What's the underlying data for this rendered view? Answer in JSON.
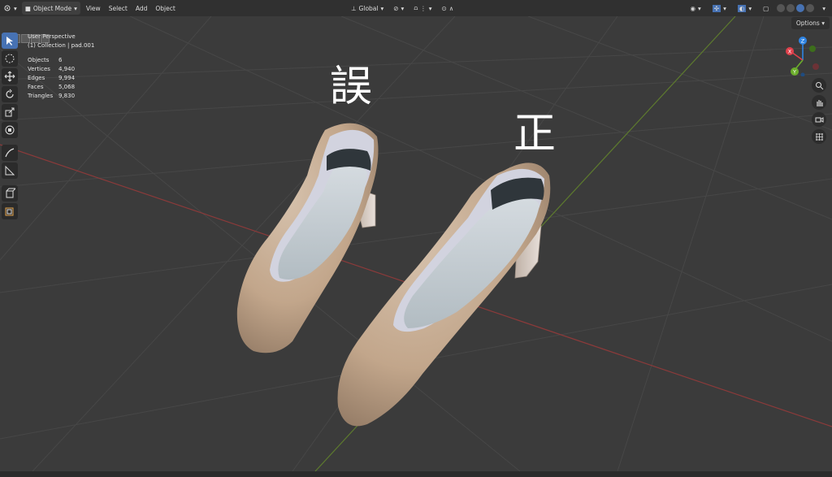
{
  "header": {
    "mode_label": "Object Mode",
    "menus": [
      "View",
      "Select",
      "Add",
      "Object"
    ],
    "transform_orientation": "Global"
  },
  "viewport": {
    "view_name": "User Perspective",
    "collection_line": "(1) Collection | pad.001",
    "stats": [
      {
        "label": "Objects",
        "value": "6"
      },
      {
        "label": "Vertices",
        "value": "4,940"
      },
      {
        "label": "Edges",
        "value": "9,994"
      },
      {
        "label": "Faces",
        "value": "5,068"
      },
      {
        "label": "Triangles",
        "value": "9,830"
      }
    ],
    "options_label": "Options",
    "annotation_wrong": "誤",
    "annotation_right": "正"
  },
  "gizmo": {
    "x_label": "X",
    "y_label": "Y",
    "z_label": "Z"
  },
  "colors": {
    "accent": "#4772b3",
    "x_axis": "#e0414c",
    "y_axis": "#6cae2c",
    "z_axis": "#2f84e3"
  }
}
